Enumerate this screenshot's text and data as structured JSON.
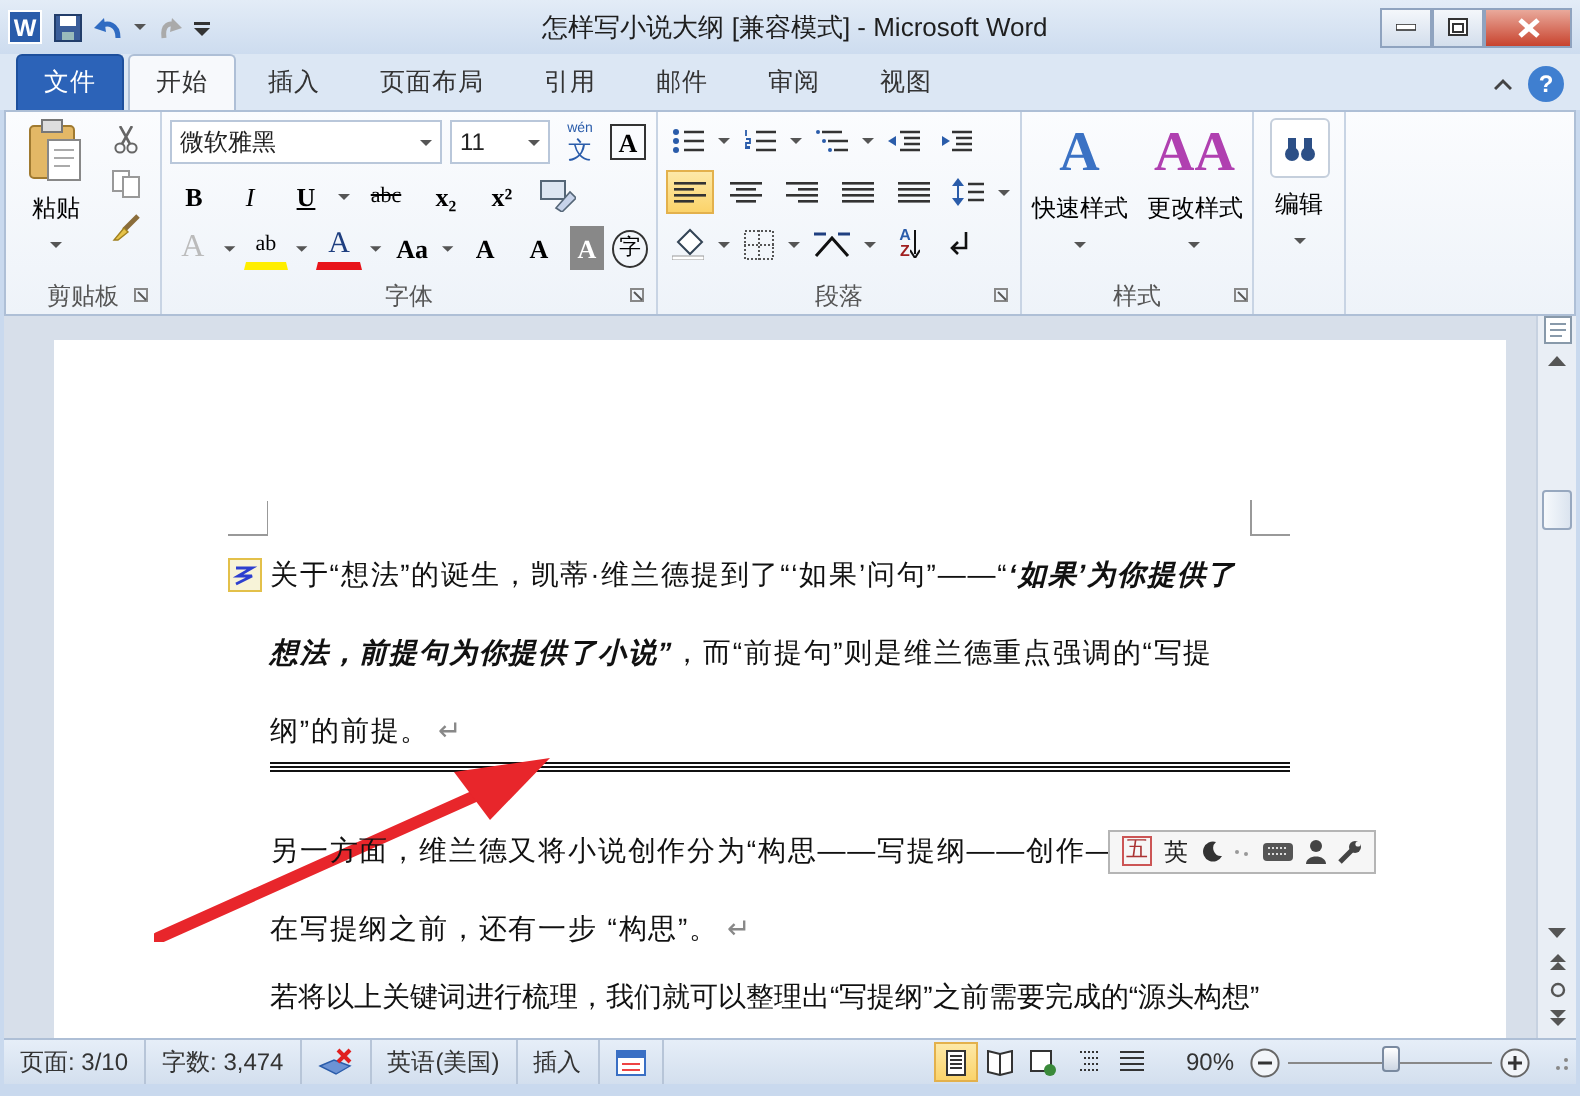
{
  "window": {
    "app_icon": "W",
    "title": "怎样写小说大纲 [兼容模式]  -  Microsoft Word"
  },
  "tabs": [
    {
      "label": "文件",
      "kind": "file",
      "selected": false
    },
    {
      "label": "开始",
      "kind": "tab",
      "selected": true
    },
    {
      "label": "插入",
      "kind": "tab",
      "selected": false
    },
    {
      "label": "页面布局",
      "kind": "tab",
      "selected": false
    },
    {
      "label": "引用",
      "kind": "tab",
      "selected": false
    },
    {
      "label": "邮件",
      "kind": "tab",
      "selected": false
    },
    {
      "label": "审阅",
      "kind": "tab",
      "selected": false
    },
    {
      "label": "视图",
      "kind": "tab",
      "selected": false
    }
  ],
  "help": "?",
  "clipboard": {
    "label": "剪贴板",
    "paste": "粘贴"
  },
  "font": {
    "label": "字体",
    "font_name": "微软雅黑",
    "font_size": "11",
    "phonetic_top": "wén",
    "phonetic_char": "文",
    "border_char": "A",
    "row1": [
      {
        "glyph": "B",
        "kind": "bold"
      },
      {
        "glyph": "I",
        "kind": "italic"
      },
      {
        "glyph": "U",
        "kind": "underline"
      },
      {
        "glyph": "abc",
        "kind": "strike"
      },
      {
        "glyph": "x₂",
        "kind": "plain"
      },
      {
        "glyph": "x²",
        "kind": "plain"
      }
    ],
    "row2": [
      {
        "glyph": "A",
        "kind": "effect"
      },
      {
        "glyph": "ab",
        "kind": "highlight"
      },
      {
        "glyph": "A",
        "kind": "color"
      },
      {
        "glyph": "Aa",
        "kind": "plain"
      },
      {
        "glyph": "A",
        "kind": "plain"
      },
      {
        "glyph": "A",
        "kind": "plain"
      },
      {
        "glyph": "A",
        "kind": "shade"
      },
      {
        "glyph": "字",
        "kind": "circle"
      }
    ]
  },
  "paragraph": {
    "label": "段落",
    "alignments": [
      {
        "selected": true
      },
      {
        "selected": false
      },
      {
        "selected": false
      },
      {
        "selected": false
      },
      {
        "selected": false
      }
    ],
    "sort": [
      "A",
      "Z"
    ]
  },
  "styles": {
    "label": "样式",
    "quick_glyph": "A",
    "quick": "快速样式",
    "change_glyph": "AA",
    "change": "更改样式"
  },
  "editing": {
    "label": "编辑"
  },
  "document": {
    "paragraphs": [
      {
        "runs": [
          {
            "text": "关于“想法”的诞生，凯蒂·维兰德提到了“‘如果’问句”——“",
            "emphasis": false
          },
          {
            "text": "‘如果’为你提供了想法，前提句为你提供了小说”",
            "emphasis": true
          },
          {
            "text": "，而“前提句”则是维兰德重点强调的“写提纲”的前提。",
            "emphasis": false
          }
        ],
        "mark": "↵",
        "rule": true
      },
      {
        "runs": [
          {
            "text": "另一方面，维兰德又将小说创作分为“构思——写提纲——创作—",
            "emphasis": false
          }
        ],
        "rule": false
      },
      {
        "runs": [
          {
            "text": "在写提纲之前，还有一步 “构思”。",
            "emphasis": false
          }
        ],
        "mark": "↵",
        "rule": false
      },
      {
        "runs": [
          {
            "text": "若将以上关键词进行梳理，我们就可以整理出“写提纲”之前需要完成的“源头构想”",
            "emphasis": false
          }
        ],
        "rule": false
      }
    ]
  },
  "ime_toolbar": {
    "mode": "五",
    "language": "英"
  },
  "status_bar": {
    "page": "页面: 3/10",
    "words": "字数: 3,474",
    "language": "英语(美国)",
    "insert": "插入",
    "views": [
      {
        "selected": true
      },
      {
        "selected": false
      },
      {
        "selected": false
      },
      {
        "selected": false
      },
      {
        "selected": false
      }
    ],
    "zoom": "90%",
    "zoom_slider": {
      "level": 0.5
    }
  }
}
